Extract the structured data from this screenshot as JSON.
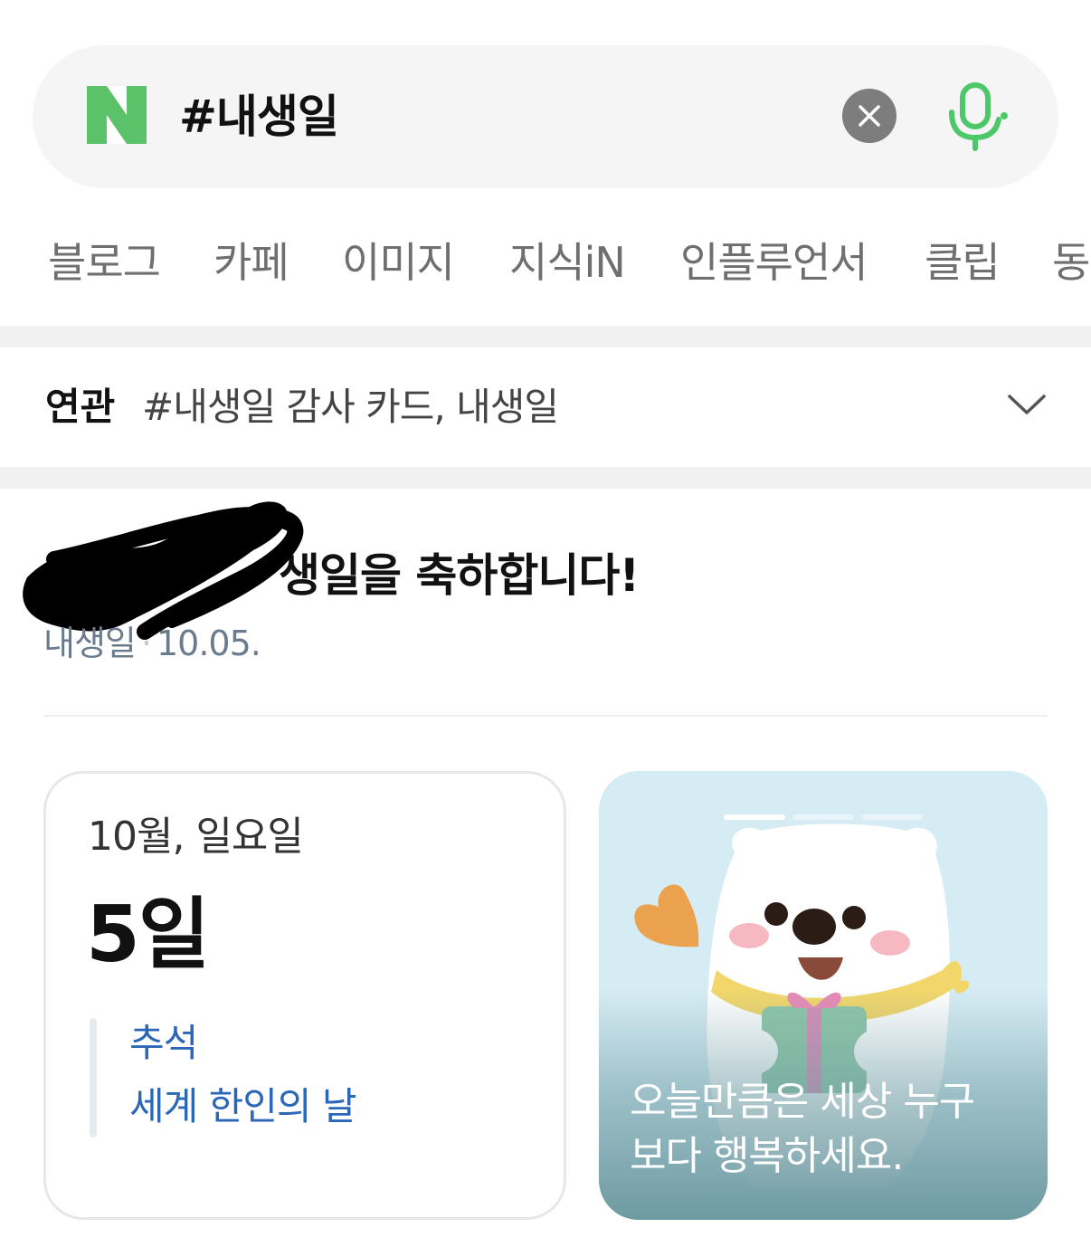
{
  "search": {
    "logo": "N",
    "query": "#내생일",
    "clear_icon": "close-icon",
    "mic_icon": "microphone-icon"
  },
  "tabs": [
    "블로그",
    "카페",
    "이미지",
    "지식iN",
    "인플루언서",
    "클립",
    "동"
  ],
  "related": {
    "label": "연관",
    "text": "#내생일 감사 카드, 내생일"
  },
  "greeting": {
    "name": "생",
    "message": "생일을 축하합니다!",
    "meta_source": "내생일",
    "meta_date": "10.05."
  },
  "calendar": {
    "month_weekday": "10월, 일요일",
    "day": "5일",
    "events": [
      "추석",
      "세계 한인의 날"
    ]
  },
  "photo": {
    "caption_line1": "오늘만큼은 세상 누구",
    "caption_line2": "보다 행복하세요.",
    "slides_total": 3,
    "slide_active": 1
  },
  "colors": {
    "brand_green": "#03c75a",
    "link_blue": "#2b67b8",
    "tab_gray": "#6f6f6f"
  }
}
